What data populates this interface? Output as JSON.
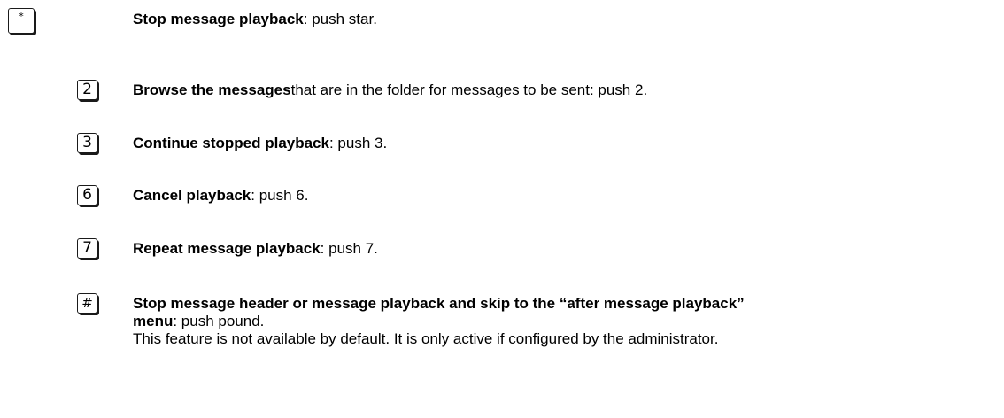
{
  "items": [
    {
      "key": "*",
      "key_icon": "star-key-icon",
      "bold": "Stop message playback",
      "rest": ": push star."
    },
    {
      "key": "2",
      "key_icon": "key-2-icon",
      "bold": "Browse the messages",
      "rest": "that are in the folder for messages to be sent: push 2."
    },
    {
      "key": "3",
      "key_icon": "key-3-icon",
      "bold": "Continue stopped playback",
      "rest": ": push 3."
    },
    {
      "key": "6",
      "key_icon": "key-6-icon",
      "bold": "Cancel playback",
      "rest": ": push 6."
    },
    {
      "key": "7",
      "key_icon": "key-7-icon",
      "bold": "Repeat message playback",
      "rest": ": push 7."
    },
    {
      "key": "#",
      "key_icon": "pound-key-icon",
      "bold_line1": "Stop message header or message playback and skip to the “after message playback”",
      "bold_line2": "menu",
      "rest_line2": ": push pound.",
      "note": "This feature is not available by default. It is only active if configured by the administrator."
    }
  ]
}
